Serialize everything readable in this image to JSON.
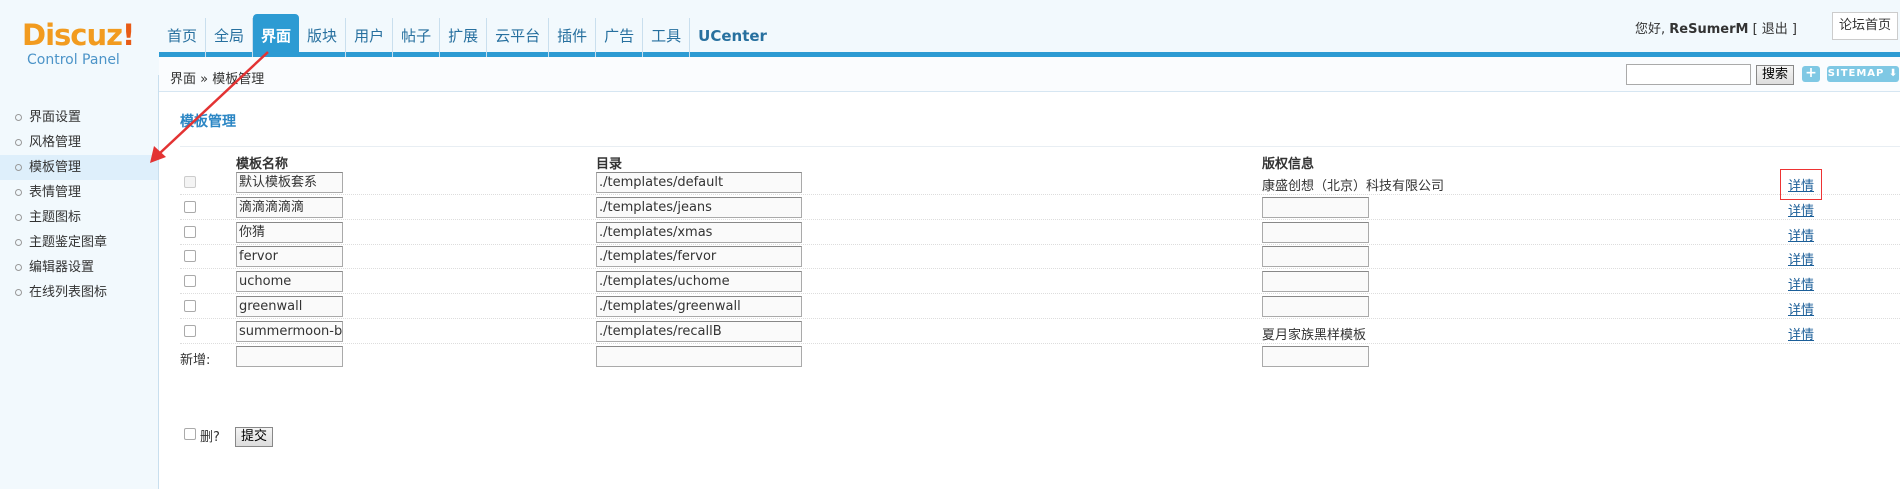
{
  "logo": {
    "text": "Discuz",
    "bang": "!",
    "subtitle": "Control Panel"
  },
  "nav": {
    "items": [
      "首页",
      "全局",
      "界面",
      "版块",
      "用户",
      "帖子",
      "扩展",
      "云平台",
      "插件",
      "广告",
      "工具",
      "UCenter"
    ],
    "active": "界面"
  },
  "user": {
    "greeting": "您好,",
    "name": "ReSumerM",
    "logout": "[ 退出 ]"
  },
  "forum_home": "论坛首页",
  "breadcrumb": "界面 » 模板管理",
  "search": {
    "button": "搜索",
    "value": ""
  },
  "add_label": "+",
  "sitemap_label": "SITEMAP ⬇",
  "sidebar": {
    "items": [
      "界面设置",
      "风格管理",
      "模板管理",
      "表情管理",
      "主题图标",
      "主题鉴定图章",
      "编辑器设置",
      "在线列表图标"
    ],
    "active": "模板管理"
  },
  "section_title": "模板管理",
  "table": {
    "headers": {
      "name": "模板名称",
      "dir": "目录",
      "copyright": "版权信息"
    },
    "rows": [
      {
        "name": "默认模板套系",
        "dir": "./templates/default",
        "copyright": "康盛创想（北京）科技有限公司",
        "detail": "详情"
      },
      {
        "name": "滴滴滴滴滴",
        "dir": "./templates/jeans",
        "copyright": "",
        "detail": "详情"
      },
      {
        "name": "你猜",
        "dir": "./templates/xmas",
        "copyright": "",
        "detail": "详情"
      },
      {
        "name": "fervor",
        "dir": "./templates/fervor",
        "copyright": "",
        "detail": "详情"
      },
      {
        "name": "uchome",
        "dir": "./templates/uchome",
        "copyright": "",
        "detail": "详情"
      },
      {
        "name": "greenwall",
        "dir": "./templates/greenwall",
        "copyright": "",
        "detail": "详情"
      },
      {
        "name": "summermoon-bl",
        "dir": "./templates/recallB",
        "copyright": "夏月家族黑样模板",
        "detail": "详情"
      }
    ],
    "new_label": "新增:"
  },
  "delete_label": "删?",
  "submit_label": "提交",
  "colors": {
    "accent": "#2d9bd3",
    "link": "#1b5e98",
    "highlight_box": "#e33333",
    "arrow": "#e33333"
  }
}
